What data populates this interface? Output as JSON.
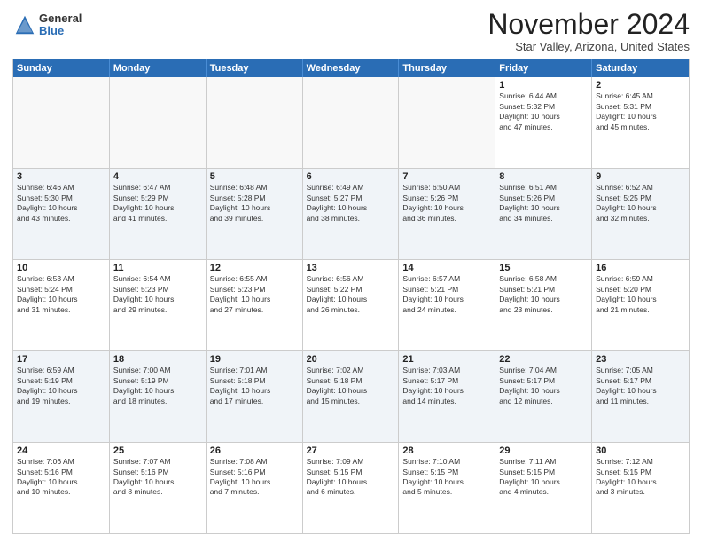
{
  "logo": {
    "general": "General",
    "blue": "Blue"
  },
  "header": {
    "month": "November 2024",
    "location": "Star Valley, Arizona, United States"
  },
  "weekdays": [
    "Sunday",
    "Monday",
    "Tuesday",
    "Wednesday",
    "Thursday",
    "Friday",
    "Saturday"
  ],
  "rows": [
    {
      "alt": false,
      "cells": [
        {
          "empty": true,
          "day": "",
          "info": ""
        },
        {
          "empty": true,
          "day": "",
          "info": ""
        },
        {
          "empty": true,
          "day": "",
          "info": ""
        },
        {
          "empty": true,
          "day": "",
          "info": ""
        },
        {
          "empty": true,
          "day": "",
          "info": ""
        },
        {
          "empty": false,
          "day": "1",
          "info": "Sunrise: 6:44 AM\nSunset: 5:32 PM\nDaylight: 10 hours\nand 47 minutes."
        },
        {
          "empty": false,
          "day": "2",
          "info": "Sunrise: 6:45 AM\nSunset: 5:31 PM\nDaylight: 10 hours\nand 45 minutes."
        }
      ]
    },
    {
      "alt": true,
      "cells": [
        {
          "empty": false,
          "day": "3",
          "info": "Sunrise: 6:46 AM\nSunset: 5:30 PM\nDaylight: 10 hours\nand 43 minutes."
        },
        {
          "empty": false,
          "day": "4",
          "info": "Sunrise: 6:47 AM\nSunset: 5:29 PM\nDaylight: 10 hours\nand 41 minutes."
        },
        {
          "empty": false,
          "day": "5",
          "info": "Sunrise: 6:48 AM\nSunset: 5:28 PM\nDaylight: 10 hours\nand 39 minutes."
        },
        {
          "empty": false,
          "day": "6",
          "info": "Sunrise: 6:49 AM\nSunset: 5:27 PM\nDaylight: 10 hours\nand 38 minutes."
        },
        {
          "empty": false,
          "day": "7",
          "info": "Sunrise: 6:50 AM\nSunset: 5:26 PM\nDaylight: 10 hours\nand 36 minutes."
        },
        {
          "empty": false,
          "day": "8",
          "info": "Sunrise: 6:51 AM\nSunset: 5:26 PM\nDaylight: 10 hours\nand 34 minutes."
        },
        {
          "empty": false,
          "day": "9",
          "info": "Sunrise: 6:52 AM\nSunset: 5:25 PM\nDaylight: 10 hours\nand 32 minutes."
        }
      ]
    },
    {
      "alt": false,
      "cells": [
        {
          "empty": false,
          "day": "10",
          "info": "Sunrise: 6:53 AM\nSunset: 5:24 PM\nDaylight: 10 hours\nand 31 minutes."
        },
        {
          "empty": false,
          "day": "11",
          "info": "Sunrise: 6:54 AM\nSunset: 5:23 PM\nDaylight: 10 hours\nand 29 minutes."
        },
        {
          "empty": false,
          "day": "12",
          "info": "Sunrise: 6:55 AM\nSunset: 5:23 PM\nDaylight: 10 hours\nand 27 minutes."
        },
        {
          "empty": false,
          "day": "13",
          "info": "Sunrise: 6:56 AM\nSunset: 5:22 PM\nDaylight: 10 hours\nand 26 minutes."
        },
        {
          "empty": false,
          "day": "14",
          "info": "Sunrise: 6:57 AM\nSunset: 5:21 PM\nDaylight: 10 hours\nand 24 minutes."
        },
        {
          "empty": false,
          "day": "15",
          "info": "Sunrise: 6:58 AM\nSunset: 5:21 PM\nDaylight: 10 hours\nand 23 minutes."
        },
        {
          "empty": false,
          "day": "16",
          "info": "Sunrise: 6:59 AM\nSunset: 5:20 PM\nDaylight: 10 hours\nand 21 minutes."
        }
      ]
    },
    {
      "alt": true,
      "cells": [
        {
          "empty": false,
          "day": "17",
          "info": "Sunrise: 6:59 AM\nSunset: 5:19 PM\nDaylight: 10 hours\nand 19 minutes."
        },
        {
          "empty": false,
          "day": "18",
          "info": "Sunrise: 7:00 AM\nSunset: 5:19 PM\nDaylight: 10 hours\nand 18 minutes."
        },
        {
          "empty": false,
          "day": "19",
          "info": "Sunrise: 7:01 AM\nSunset: 5:18 PM\nDaylight: 10 hours\nand 17 minutes."
        },
        {
          "empty": false,
          "day": "20",
          "info": "Sunrise: 7:02 AM\nSunset: 5:18 PM\nDaylight: 10 hours\nand 15 minutes."
        },
        {
          "empty": false,
          "day": "21",
          "info": "Sunrise: 7:03 AM\nSunset: 5:17 PM\nDaylight: 10 hours\nand 14 minutes."
        },
        {
          "empty": false,
          "day": "22",
          "info": "Sunrise: 7:04 AM\nSunset: 5:17 PM\nDaylight: 10 hours\nand 12 minutes."
        },
        {
          "empty": false,
          "day": "23",
          "info": "Sunrise: 7:05 AM\nSunset: 5:17 PM\nDaylight: 10 hours\nand 11 minutes."
        }
      ]
    },
    {
      "alt": false,
      "cells": [
        {
          "empty": false,
          "day": "24",
          "info": "Sunrise: 7:06 AM\nSunset: 5:16 PM\nDaylight: 10 hours\nand 10 minutes."
        },
        {
          "empty": false,
          "day": "25",
          "info": "Sunrise: 7:07 AM\nSunset: 5:16 PM\nDaylight: 10 hours\nand 8 minutes."
        },
        {
          "empty": false,
          "day": "26",
          "info": "Sunrise: 7:08 AM\nSunset: 5:16 PM\nDaylight: 10 hours\nand 7 minutes."
        },
        {
          "empty": false,
          "day": "27",
          "info": "Sunrise: 7:09 AM\nSunset: 5:15 PM\nDaylight: 10 hours\nand 6 minutes."
        },
        {
          "empty": false,
          "day": "28",
          "info": "Sunrise: 7:10 AM\nSunset: 5:15 PM\nDaylight: 10 hours\nand 5 minutes."
        },
        {
          "empty": false,
          "day": "29",
          "info": "Sunrise: 7:11 AM\nSunset: 5:15 PM\nDaylight: 10 hours\nand 4 minutes."
        },
        {
          "empty": false,
          "day": "30",
          "info": "Sunrise: 7:12 AM\nSunset: 5:15 PM\nDaylight: 10 hours\nand 3 minutes."
        }
      ]
    }
  ]
}
